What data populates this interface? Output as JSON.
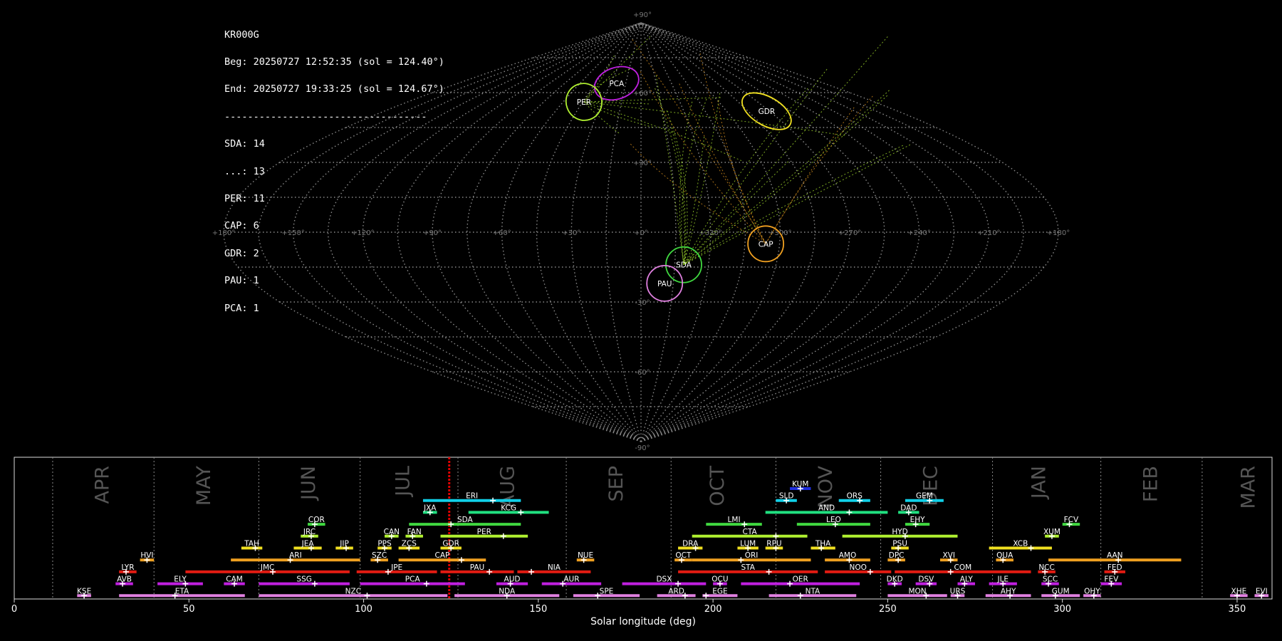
{
  "info": {
    "station": "KR000G",
    "beg": "Beg: 20250727 12:52:35 (sol = 124.40°)",
    "end": "End: 20250727 19:33:25 (sol = 124.67°)",
    "divider": "-----------------------------------",
    "counts": [
      "SDA: 14",
      "...: 13",
      "PER: 11",
      "CAP: 6",
      "GDR: 2",
      "PAU: 1",
      "PCA: 1"
    ]
  },
  "colors": {
    "background": "#000000",
    "grid": "#8a8a8a",
    "red": "#e01b12",
    "orange": "#f0a020",
    "yellow": "#f0e020",
    "yellowgreen": "#b0f030",
    "green": "#40d840",
    "teal": "#20e080",
    "cyan": "#10d0e8",
    "blue": "#2030e0",
    "magenta": "#c020e0",
    "pink": "#e080e0",
    "current": "#e00000"
  },
  "chart_data": [
    {
      "type": "scatter",
      "projection": "sinusoidal",
      "grid": true,
      "lon_labels": [
        "+180°",
        "+150°",
        "+120°",
        "+90°",
        "+60°",
        "+30°",
        "+0°",
        "+330°",
        "+300°",
        "+270°",
        "+240°",
        "+210°",
        "+180°"
      ],
      "lat_labels": [
        "+90°",
        "+60°",
        "+30°",
        "-30°",
        "-60°",
        "-90°"
      ],
      "radiants": [
        {
          "name": "PCA",
          "ra": 24,
          "dec": 64,
          "color": "#c020e0",
          "rx": 32,
          "ry": 22,
          "rot": -20
        },
        {
          "name": "PER",
          "ra": 44,
          "dec": 56,
          "color": "#b0f030",
          "rx": 25,
          "ry": 26,
          "rot": -20
        },
        {
          "name": "GDR",
          "ra": 272,
          "dec": 52,
          "color": "#f0e020",
          "rx": 38,
          "ry": 20,
          "rot": 30
        },
        {
          "name": "CAP",
          "ra": 306,
          "dec": -5,
          "color": "#f0a020",
          "rx": 25,
          "ry": 25,
          "rot": 0
        },
        {
          "name": "SDA",
          "ra": 341,
          "dec": -14,
          "color": "#40d840",
          "rx": 25,
          "ry": 25,
          "rot": 0
        },
        {
          "name": "PAU",
          "ra": 349,
          "dec": -22,
          "color": "#e080e0",
          "rx": 25,
          "ry": 25,
          "rot": 0
        }
      ]
    },
    {
      "type": "bar",
      "xlabel": "Solar longitude (deg)",
      "xlim": [
        0,
        360
      ],
      "xticks": [
        0,
        50,
        100,
        150,
        200,
        250,
        300,
        350
      ],
      "current_sol": 124.5,
      "months": [
        {
          "label": "APR",
          "start": 11,
          "mid": 25
        },
        {
          "label": "MAY",
          "start": 40,
          "mid": 54
        },
        {
          "label": "JUN",
          "start": 70,
          "mid": 84
        },
        {
          "label": "JUL",
          "start": 99,
          "mid": 111
        },
        {
          "label": "AUG",
          "start": 127,
          "mid": 141
        },
        {
          "label": "SEP",
          "start": 158,
          "mid": 172
        },
        {
          "label": "OCT",
          "start": 188,
          "mid": 201
        },
        {
          "label": "NOV",
          "start": 218,
          "mid": 232
        },
        {
          "label": "DEC",
          "start": 248,
          "mid": 262
        },
        {
          "label": "JAN",
          "start": 280,
          "mid": 293
        },
        {
          "label": "FEB",
          "start": 311,
          "mid": 325
        },
        {
          "label": "MAR",
          "start": 340,
          "mid": 353
        }
      ],
      "showers": [
        {
          "name": "KUM",
          "row": 0,
          "start": 222,
          "end": 228,
          "peak": 225,
          "color": "#2030e0"
        },
        {
          "name": "ERI",
          "row": 1,
          "start": 117,
          "end": 145,
          "peak": 137,
          "color": "#10d0e8"
        },
        {
          "name": "SLD",
          "row": 1,
          "start": 218,
          "end": 224,
          "peak": 221,
          "color": "#10d0e8"
        },
        {
          "name": "ORS",
          "row": 1,
          "start": 236,
          "end": 245,
          "peak": 242,
          "color": "#10d0e8"
        },
        {
          "name": "GEM",
          "row": 1,
          "start": 255,
          "end": 266,
          "peak": 262,
          "color": "#10d0e8"
        },
        {
          "name": "JXA",
          "row": 2,
          "start": 117,
          "end": 121,
          "peak": 119,
          "color": "#20e080"
        },
        {
          "name": "KCG",
          "row": 2,
          "start": 130,
          "end": 153,
          "peak": 145,
          "color": "#20e080"
        },
        {
          "name": "AND",
          "row": 2,
          "start": 215,
          "end": 250,
          "peak": 239,
          "color": "#20e080"
        },
        {
          "name": "DAD",
          "row": 2,
          "start": 253,
          "end": 259,
          "peak": 256,
          "color": "#20e080"
        },
        {
          "name": "COR",
          "row": 3,
          "start": 84,
          "end": 89,
          "peak": 86,
          "color": "#40d840"
        },
        {
          "name": "SDA",
          "row": 3,
          "start": 113,
          "end": 145,
          "peak": 125,
          "color": "#40d840"
        },
        {
          "name": "LMI",
          "row": 3,
          "start": 198,
          "end": 214,
          "peak": 209,
          "color": "#40d840"
        },
        {
          "name": "LEO",
          "row": 3,
          "start": 224,
          "end": 245,
          "peak": 235,
          "color": "#40d840"
        },
        {
          "name": "EHY",
          "row": 3,
          "start": 255,
          "end": 262,
          "peak": 258,
          "color": "#40d840"
        },
        {
          "name": "FCV",
          "row": 3,
          "start": 300,
          "end": 305,
          "peak": 302,
          "color": "#40d840"
        },
        {
          "name": "JRC",
          "row": 4,
          "start": 82,
          "end": 87,
          "peak": 85,
          "color": "#b0f030"
        },
        {
          "name": "CAN",
          "row": 4,
          "start": 106,
          "end": 110,
          "peak": 108,
          "color": "#b0f030"
        },
        {
          "name": "FAN",
          "row": 4,
          "start": 112,
          "end": 117,
          "peak": 114,
          "color": "#b0f030"
        },
        {
          "name": "PER",
          "row": 4,
          "start": 122,
          "end": 147,
          "peak": 140,
          "color": "#b0f030"
        },
        {
          "name": "CTA",
          "row": 4,
          "start": 194,
          "end": 227,
          "peak": 218,
          "color": "#b0f030"
        },
        {
          "name": "HYD",
          "row": 4,
          "start": 237,
          "end": 270,
          "peak": 255,
          "color": "#b0f030"
        },
        {
          "name": "XUM",
          "row": 4,
          "start": 295,
          "end": 299,
          "peak": 297,
          "color": "#b0f030"
        },
        {
          "name": "TAH",
          "row": 5,
          "start": 65,
          "end": 71,
          "peak": 69,
          "color": "#f0e020"
        },
        {
          "name": "JEA",
          "row": 5,
          "start": 80,
          "end": 88,
          "peak": 85,
          "color": "#f0e020"
        },
        {
          "name": "JIP",
          "row": 5,
          "start": 92,
          "end": 97,
          "peak": 95,
          "color": "#f0e020"
        },
        {
          "name": "PPS",
          "row": 5,
          "start": 104,
          "end": 108,
          "peak": 106,
          "color": "#f0e020"
        },
        {
          "name": "ZCS",
          "row": 5,
          "start": 110,
          "end": 116,
          "peak": 113,
          "color": "#f0e020"
        },
        {
          "name": "GDR",
          "row": 5,
          "start": 122,
          "end": 128,
          "peak": 125,
          "color": "#f0e020"
        },
        {
          "name": "DRA",
          "row": 5,
          "start": 190,
          "end": 197,
          "peak": 195,
          "color": "#f0e020"
        },
        {
          "name": "LUM",
          "row": 5,
          "start": 207,
          "end": 213,
          "peak": 210,
          "color": "#f0e020"
        },
        {
          "name": "RPU",
          "row": 5,
          "start": 215,
          "end": 220,
          "peak": 218,
          "color": "#f0e020"
        },
        {
          "name": "THA",
          "row": 5,
          "start": 228,
          "end": 235,
          "peak": 231,
          "color": "#f0e020"
        },
        {
          "name": "PSU",
          "row": 5,
          "start": 251,
          "end": 256,
          "peak": 253,
          "color": "#f0e020"
        },
        {
          "name": "XCB",
          "row": 5,
          "start": 279,
          "end": 297,
          "peak": 291,
          "color": "#f0e020"
        },
        {
          "name": "HVI",
          "row": 6,
          "start": 36,
          "end": 40,
          "peak": 38,
          "color": "#f0a020"
        },
        {
          "name": "ARI",
          "row": 6,
          "start": 62,
          "end": 99,
          "peak": 79,
          "color": "#f0a020"
        },
        {
          "name": "SZC",
          "row": 6,
          "start": 102,
          "end": 107,
          "peak": 104,
          "color": "#f0a020"
        },
        {
          "name": "CAP",
          "row": 6,
          "start": 110,
          "end": 135,
          "peak": 128,
          "color": "#f0a020"
        },
        {
          "name": "NUE",
          "row": 6,
          "start": 161,
          "end": 166,
          "peak": 163,
          "color": "#f0a020"
        },
        {
          "name": "OCT",
          "row": 6,
          "start": 189,
          "end": 194,
          "peak": 191,
          "color": "#f0a020"
        },
        {
          "name": "ORI",
          "row": 6,
          "start": 194,
          "end": 228,
          "peak": 208,
          "color": "#f0a020"
        },
        {
          "name": "AMO",
          "row": 6,
          "start": 232,
          "end": 245,
          "peak": 239,
          "color": "#f0a020"
        },
        {
          "name": "DPC",
          "row": 6,
          "start": 250,
          "end": 255,
          "peak": 253,
          "color": "#f0a020"
        },
        {
          "name": "XVI",
          "row": 6,
          "start": 265,
          "end": 270,
          "peak": 268,
          "color": "#f0a020"
        },
        {
          "name": "QUA",
          "row": 6,
          "start": 281,
          "end": 286,
          "peak": 283,
          "color": "#f0a020"
        },
        {
          "name": "AAN",
          "row": 6,
          "start": 296,
          "end": 334,
          "peak": 316,
          "color": "#f0a020"
        },
        {
          "name": "LYR",
          "row": 7,
          "start": 30,
          "end": 35,
          "peak": 32,
          "color": "#e01b12"
        },
        {
          "name": "JMC",
          "row": 7,
          "start": 49,
          "end": 96,
          "peak": 74,
          "color": "#e01b12"
        },
        {
          "name": "JPE",
          "row": 7,
          "start": 98,
          "end": 121,
          "peak": 107,
          "color": "#e01b12"
        },
        {
          "name": "PAU",
          "row": 7,
          "start": 122,
          "end": 143,
          "peak": 136,
          "color": "#e01b12"
        },
        {
          "name": "NIA",
          "row": 7,
          "start": 144,
          "end": 165,
          "peak": 148,
          "color": "#e01b12"
        },
        {
          "name": "STA",
          "row": 7,
          "start": 190,
          "end": 230,
          "peak": 216,
          "color": "#e01b12"
        },
        {
          "name": "NOO",
          "row": 7,
          "start": 232,
          "end": 251,
          "peak": 245,
          "color": "#e01b12"
        },
        {
          "name": "COM",
          "row": 7,
          "start": 252,
          "end": 291,
          "peak": 268,
          "color": "#e01b12"
        },
        {
          "name": "NCC",
          "row": 7,
          "start": 293,
          "end": 298,
          "peak": 295,
          "color": "#e01b12"
        },
        {
          "name": "FED",
          "row": 7,
          "start": 312,
          "end": 318,
          "peak": 315,
          "color": "#e01b12"
        },
        {
          "name": "AVB",
          "row": 8,
          "start": 29,
          "end": 34,
          "peak": 31,
          "color": "#c020e0"
        },
        {
          "name": "ELY",
          "row": 8,
          "start": 41,
          "end": 54,
          "peak": 49,
          "color": "#c020e0"
        },
        {
          "name": "CAM",
          "row": 8,
          "start": 60,
          "end": 66,
          "peak": 63,
          "color": "#c020e0"
        },
        {
          "name": "SSG",
          "row": 8,
          "start": 70,
          "end": 96,
          "peak": 86,
          "color": "#c020e0"
        },
        {
          "name": "PCA",
          "row": 8,
          "start": 99,
          "end": 129,
          "peak": 118,
          "color": "#c020e0"
        },
        {
          "name": "AUD",
          "row": 8,
          "start": 138,
          "end": 147,
          "peak": 142,
          "color": "#c020e0"
        },
        {
          "name": "AUR",
          "row": 8,
          "start": 151,
          "end": 168,
          "peak": 157,
          "color": "#c020e0"
        },
        {
          "name": "DSX",
          "row": 8,
          "start": 174,
          "end": 198,
          "peak": 190,
          "color": "#c020e0"
        },
        {
          "name": "OCU",
          "row": 8,
          "start": 200,
          "end": 204,
          "peak": 202,
          "color": "#c020e0"
        },
        {
          "name": "OER",
          "row": 8,
          "start": 208,
          "end": 242,
          "peak": 222,
          "color": "#c020e0"
        },
        {
          "name": "DKD",
          "row": 8,
          "start": 250,
          "end": 254,
          "peak": 252,
          "color": "#c020e0"
        },
        {
          "name": "DSV",
          "row": 8,
          "start": 258,
          "end": 264,
          "peak": 262,
          "color": "#c020e0"
        },
        {
          "name": "ALY",
          "row": 8,
          "start": 270,
          "end": 275,
          "peak": 272,
          "color": "#c020e0"
        },
        {
          "name": "JLE",
          "row": 8,
          "start": 279,
          "end": 287,
          "peak": 283,
          "color": "#c020e0"
        },
        {
          "name": "SCC",
          "row": 8,
          "start": 294,
          "end": 299,
          "peak": 296,
          "color": "#c020e0"
        },
        {
          "name": "FEV",
          "row": 8,
          "start": 311,
          "end": 317,
          "peak": 314,
          "color": "#c020e0"
        },
        {
          "name": "KSE",
          "row": 9,
          "start": 18,
          "end": 22,
          "peak": 20,
          "color": "#e080e0"
        },
        {
          "name": "ETA",
          "row": 9,
          "start": 30,
          "end": 66,
          "peak": 46,
          "color": "#e080e0"
        },
        {
          "name": "NZC",
          "row": 9,
          "start": 70,
          "end": 124,
          "peak": 101,
          "color": "#e080e0"
        },
        {
          "name": "NDA",
          "row": 9,
          "start": 126,
          "end": 156,
          "peak": 141,
          "color": "#e080e0"
        },
        {
          "name": "SPE",
          "row": 9,
          "start": 160,
          "end": 179,
          "peak": 167,
          "color": "#e080e0"
        },
        {
          "name": "ARD",
          "row": 9,
          "start": 184,
          "end": 195,
          "peak": 192,
          "color": "#e080e0"
        },
        {
          "name": "EGE",
          "row": 9,
          "start": 197,
          "end": 207,
          "peak": 198,
          "color": "#e080e0"
        },
        {
          "name": "NTA",
          "row": 9,
          "start": 216,
          "end": 241,
          "peak": 225,
          "color": "#e080e0"
        },
        {
          "name": "MON",
          "row": 9,
          "start": 250,
          "end": 267,
          "peak": 261,
          "color": "#e080e0"
        },
        {
          "name": "URS",
          "row": 9,
          "start": 268,
          "end": 272,
          "peak": 270,
          "color": "#e080e0"
        },
        {
          "name": "AHY",
          "row": 9,
          "start": 278,
          "end": 291,
          "peak": 285,
          "color": "#e080e0"
        },
        {
          "name": "GUM",
          "row": 9,
          "start": 294,
          "end": 305,
          "peak": 298,
          "color": "#e080e0"
        },
        {
          "name": "OHY",
          "row": 9,
          "start": 306,
          "end": 311,
          "peak": 309,
          "color": "#e080e0"
        },
        {
          "name": "XHE",
          "row": 9,
          "start": 348,
          "end": 353,
          "peak": 350,
          "color": "#e080e0"
        },
        {
          "name": "EVI",
          "row": 9,
          "start": 355,
          "end": 359,
          "peak": 357,
          "color": "#e080e0"
        }
      ]
    }
  ]
}
